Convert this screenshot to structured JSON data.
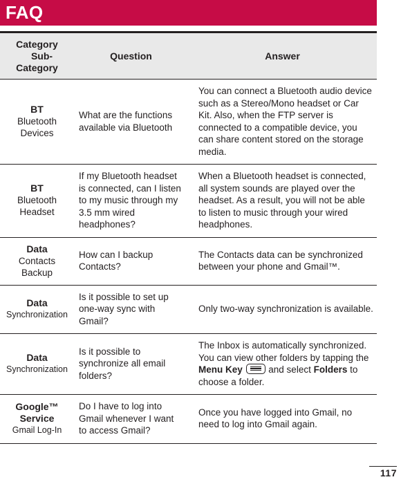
{
  "banner": {
    "title": "FAQ",
    "color": "#c60c46"
  },
  "table": {
    "headers": {
      "category_line1": "Category",
      "category_line2": "Sub-",
      "category_line3": "Category",
      "question": "Question",
      "answer": "Answer"
    },
    "header_background": "#e9e9e9",
    "rows": [
      {
        "category_main": "BT",
        "category_sub_line1": "Bluetooth",
        "category_sub_line2": "Devices",
        "question": "What are the functions available via Bluetooth",
        "answer_parts": [
          {
            "type": "text",
            "value": "You can connect a Bluetooth audio device such as a Stereo/Mono headset or Car Kit. Also, when the FTP server is connected to a compatible device, you can share content stored on the storage media."
          }
        ]
      },
      {
        "category_main": "BT",
        "category_sub_line1": "Bluetooth",
        "category_sub_line2": "Headset",
        "question": "If my Bluetooth headset is connected, can I listen to my music through my 3.5 mm wired headphones?",
        "answer_parts": [
          {
            "type": "text",
            "value": "When a Bluetooth headset is connected, all system sounds are played over the headset. As a result, you will not be able to listen to music through your wired headphones."
          }
        ]
      },
      {
        "category_main": "Data",
        "category_sub_line1": "Contacts",
        "category_sub_line2": "Backup",
        "question": "How can I backup Contacts?",
        "answer_parts": [
          {
            "type": "text",
            "value": "The Contacts data can be synchronized between your phone and Gmail™."
          }
        ]
      },
      {
        "category_main": "Data",
        "category_sub_line1": "Synchronization",
        "category_sub_line2": "",
        "question": "Is it possible to set up one-way sync with Gmail?",
        "answer_parts": [
          {
            "type": "text",
            "value": "Only two-way synchronization is available."
          }
        ]
      },
      {
        "category_main": "Data",
        "category_sub_line1": "Synchronization",
        "category_sub_line2": "",
        "question": "Is it possible to synchronize all email folders?",
        "answer_parts": [
          {
            "type": "text",
            "value": "The Inbox is automatically synchronized. You can view other folders by tapping the "
          },
          {
            "type": "bold",
            "value": "Menu Key"
          },
          {
            "type": "icon",
            "value": "menu-key-icon"
          },
          {
            "type": "text",
            "value": " and select "
          },
          {
            "type": "bold",
            "value": "Folders"
          },
          {
            "type": "text",
            "value": " to choose a folder."
          }
        ]
      },
      {
        "category_main": "Google™",
        "category_main_line2": "Service",
        "category_sub_line1": "Gmail Log-In",
        "category_sub_line2": "",
        "question": "Do I have to log into Gmail whenever I want to access Gmail?",
        "answer_parts": [
          {
            "type": "text",
            "value": "Once you have logged into Gmail, no need to log into Gmail again."
          }
        ]
      }
    ]
  },
  "footer": {
    "page_number": "117"
  }
}
